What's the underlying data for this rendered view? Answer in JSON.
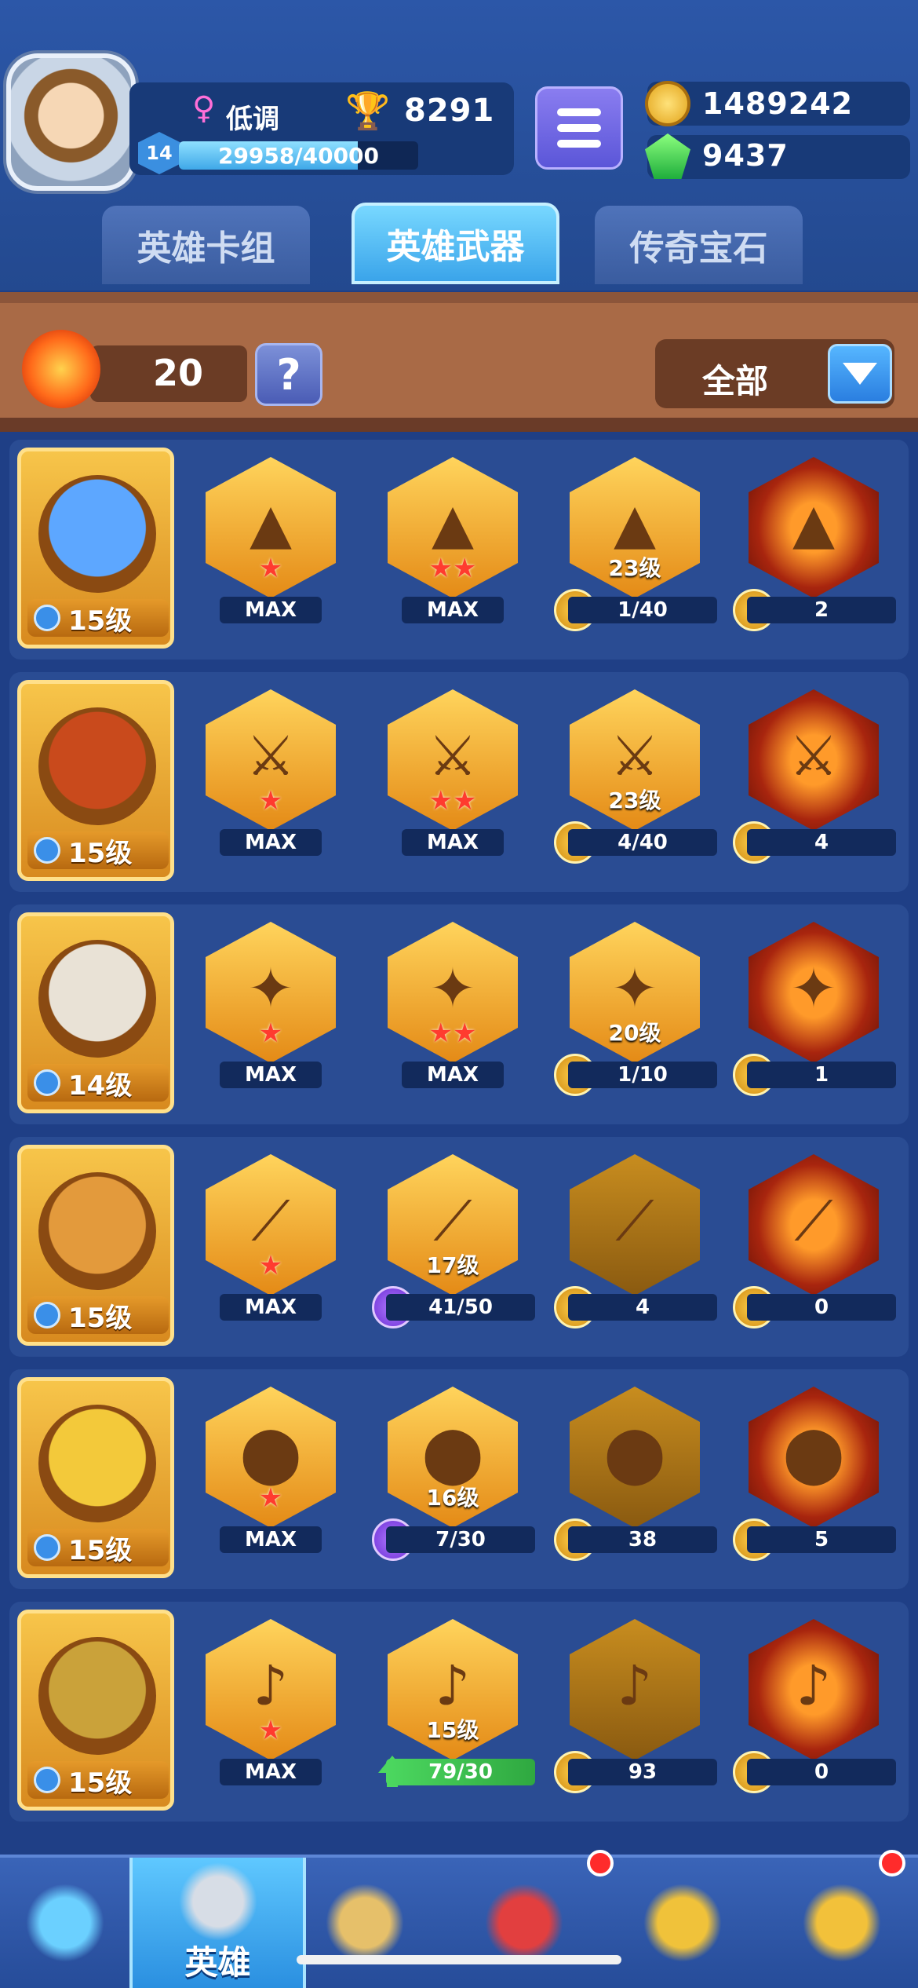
{
  "header": {
    "player_name": "低调",
    "trophies": "8291",
    "level": "14",
    "xp": "29958/40000",
    "xp_fraction": 0.749,
    "coins": "1489242",
    "gems": "9437"
  },
  "tabs": [
    {
      "label": "英雄卡组",
      "active": false
    },
    {
      "label": "英雄武器",
      "active": true
    },
    {
      "label": "传奇宝石",
      "active": false
    }
  ],
  "filter_bar": {
    "count": "20",
    "help_label": "?",
    "filter_label": "全部"
  },
  "heroes": [
    {
      "level": "15级",
      "slots": [
        {
          "stars": "★",
          "label": "MAX"
        },
        {
          "stars": "★★",
          "label": "MAX"
        },
        {
          "level": "23级",
          "label": "1/40"
        },
        {
          "label": "2"
        }
      ]
    },
    {
      "level": "15级",
      "slots": [
        {
          "stars": "★",
          "label": "MAX"
        },
        {
          "stars": "★★",
          "label": "MAX"
        },
        {
          "level": "23级",
          "label": "4/40"
        },
        {
          "label": "4"
        }
      ]
    },
    {
      "level": "14级",
      "slots": [
        {
          "stars": "★",
          "label": "MAX"
        },
        {
          "stars": "★★",
          "label": "MAX"
        },
        {
          "level": "20级",
          "label": "1/10"
        },
        {
          "label": "1"
        }
      ]
    },
    {
      "level": "15级",
      "slots": [
        {
          "stars": "★",
          "label": "MAX"
        },
        {
          "level": "17级",
          "label": "41/50"
        },
        {
          "label": "4"
        },
        {
          "label": "0"
        }
      ]
    },
    {
      "level": "15级",
      "slots": [
        {
          "stars": "★",
          "label": "MAX"
        },
        {
          "level": "16级",
          "label": "7/30"
        },
        {
          "label": "38"
        },
        {
          "label": "5"
        }
      ]
    },
    {
      "level": "15级",
      "slots": [
        {
          "stars": "★",
          "label": "MAX"
        },
        {
          "level": "15级",
          "label": "79/30"
        },
        {
          "label": "93"
        },
        {
          "label": "0"
        }
      ]
    }
  ],
  "bottom_nav": [
    {
      "icon": "treasure-chest-icon",
      "label": ""
    },
    {
      "icon": "knight-helmet-icon",
      "label": "英雄",
      "active": true
    },
    {
      "icon": "crossed-swords-icon",
      "label": ""
    },
    {
      "icon": "crown-shield-icon",
      "label": ""
    },
    {
      "icon": "friends-icon",
      "label": ""
    },
    {
      "icon": "compass-icon",
      "label": ""
    }
  ]
}
